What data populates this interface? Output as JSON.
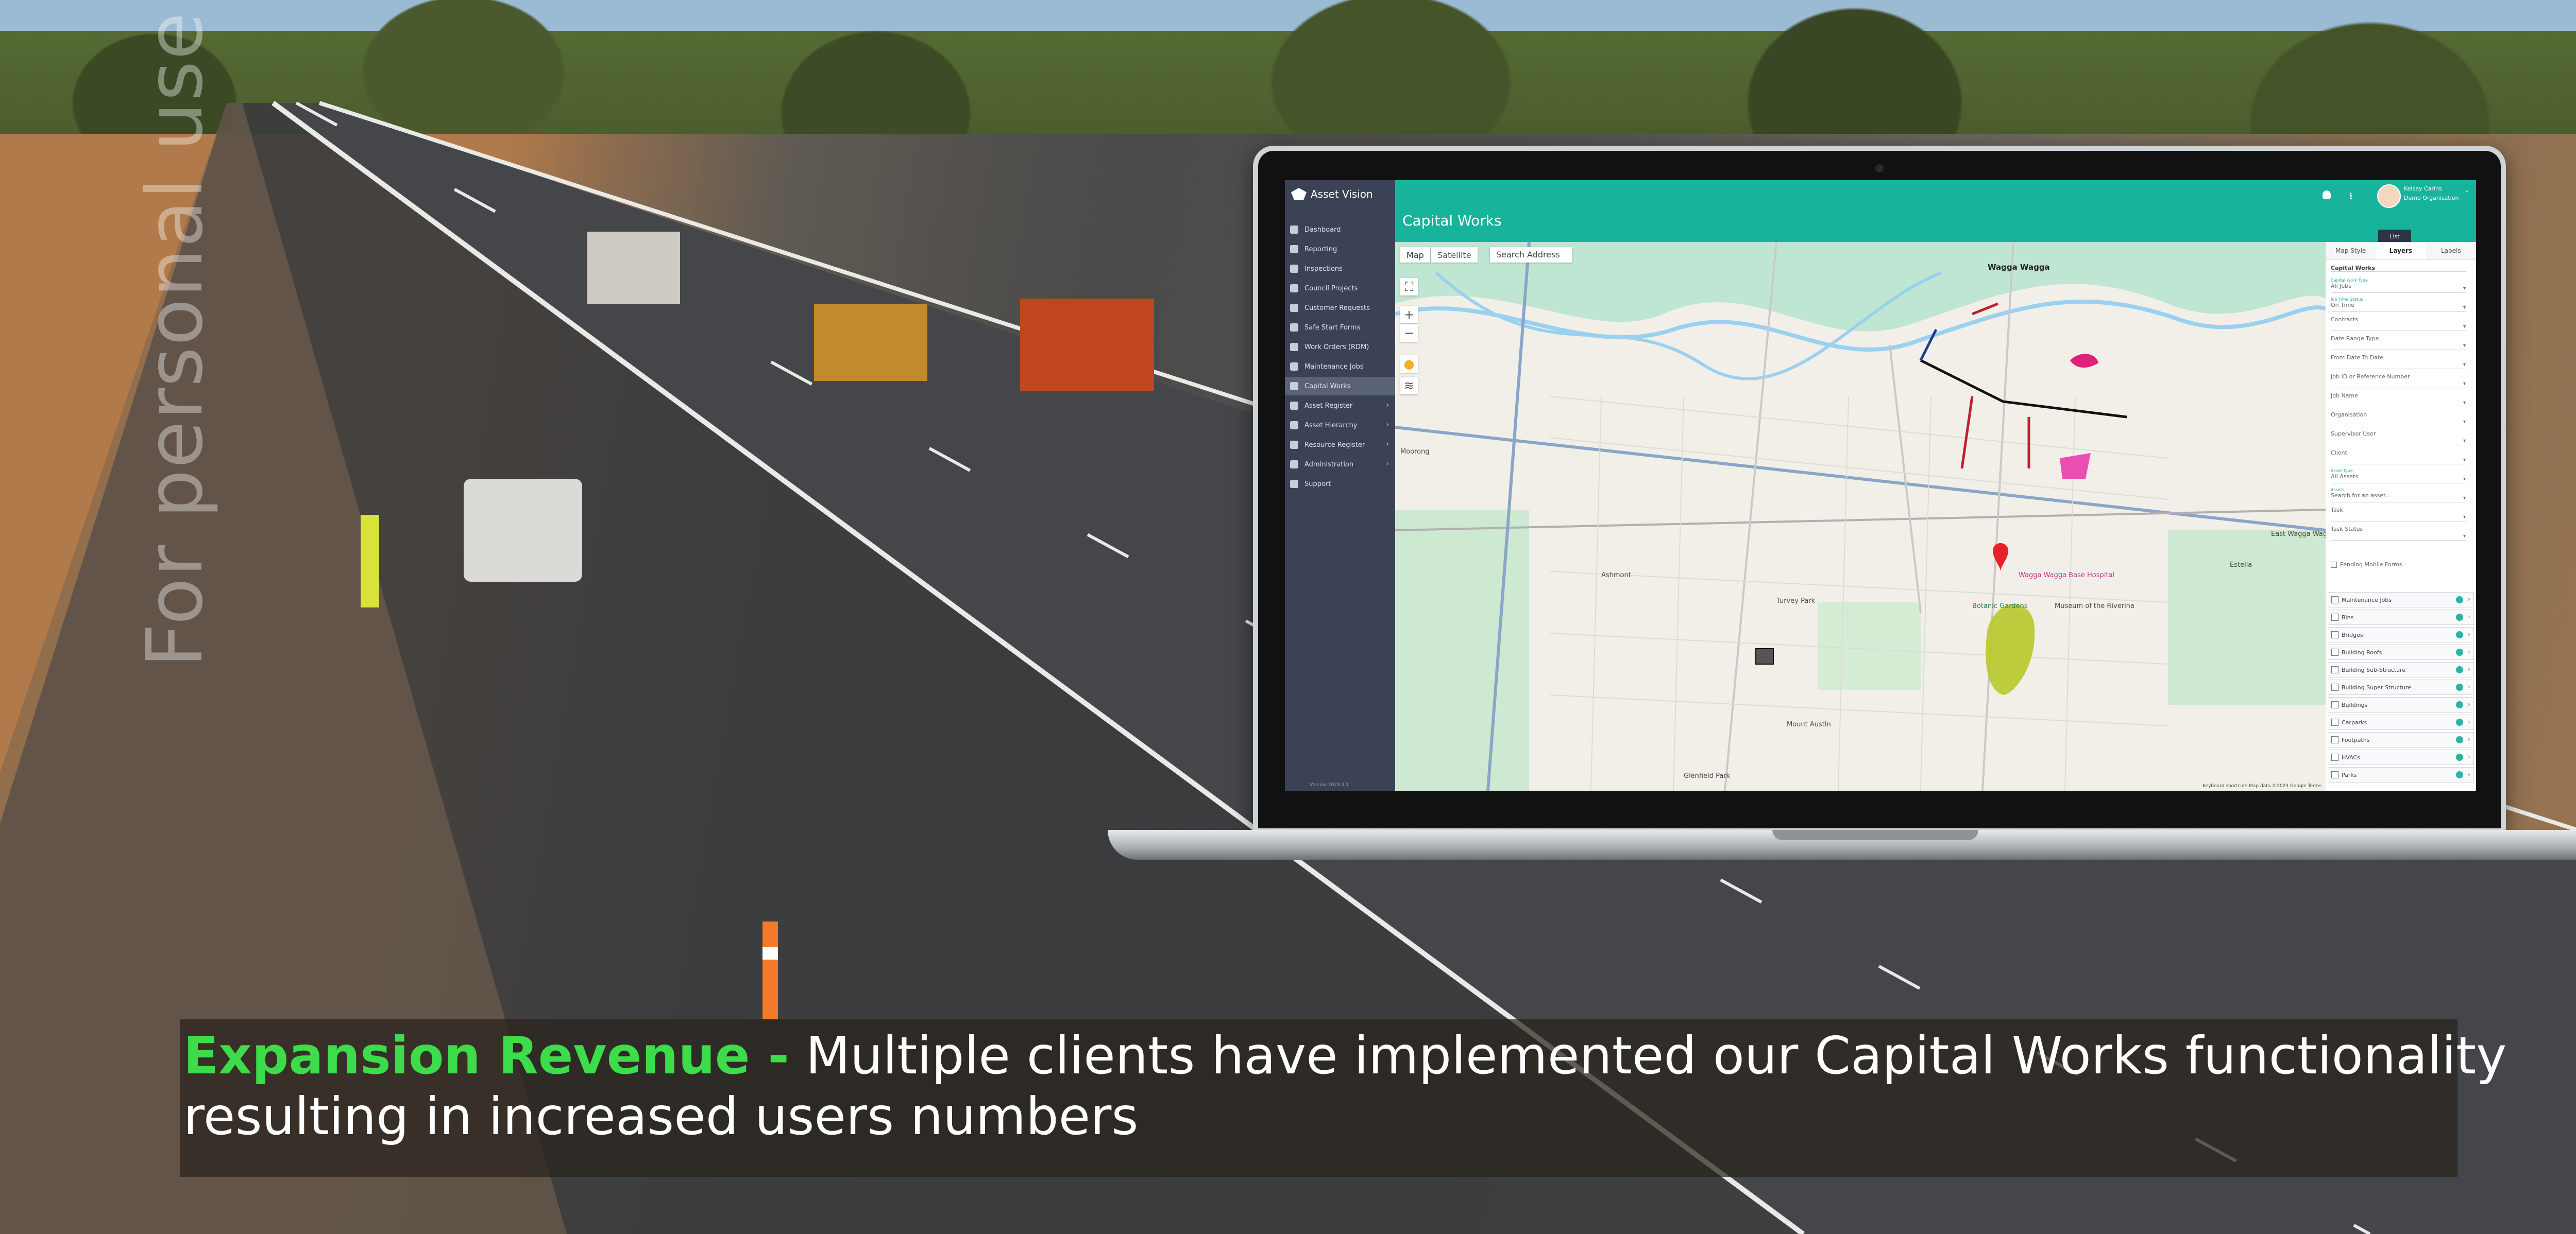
{
  "watermark": "For personal use of",
  "caption": {
    "highlight": "Expansion Revenue -",
    "line1_rest": " Multiple clients have implemented our Capital Works functionality",
    "line2": "resulting in increased users numbers",
    "highlight_color": "#3ddc4a"
  },
  "app": {
    "brand": "Asset Vision",
    "page_title": "Capital Works",
    "accent_color": "#17b39a",
    "sidebar_color": "#3b4256",
    "version": "Version 2023.3.1",
    "nav": [
      {
        "label": "Dashboard",
        "icon": "dashboard-icon",
        "chevron": false,
        "active": false
      },
      {
        "label": "Reporting",
        "icon": "reporting-icon",
        "chevron": false,
        "active": false
      },
      {
        "label": "Inspections",
        "icon": "inspections-icon",
        "chevron": false,
        "active": false
      },
      {
        "label": "Council Projects",
        "icon": "projects-icon",
        "chevron": false,
        "active": false
      },
      {
        "label": "Customer Requests",
        "icon": "requests-icon",
        "chevron": false,
        "active": false
      },
      {
        "label": "Safe Start Forms",
        "icon": "forms-icon",
        "chevron": false,
        "active": false
      },
      {
        "label": "Work Orders (RDM)",
        "icon": "work-orders-icon",
        "chevron": false,
        "active": false
      },
      {
        "label": "Maintenance Jobs",
        "icon": "maintenance-icon",
        "chevron": false,
        "active": false
      },
      {
        "label": "Capital Works",
        "icon": "capital-works-icon",
        "chevron": false,
        "active": true
      },
      {
        "label": "Asset Register",
        "icon": "asset-register-icon",
        "chevron": true,
        "active": false
      },
      {
        "label": "Asset Hierarchy",
        "icon": "hierarchy-icon",
        "chevron": true,
        "active": false
      },
      {
        "label": "Resource Register",
        "icon": "resource-icon",
        "chevron": true,
        "active": false
      },
      {
        "label": "Administration",
        "icon": "admin-icon",
        "chevron": true,
        "active": false
      },
      {
        "label": "Support",
        "icon": "support-icon",
        "chevron": false,
        "active": false
      }
    ],
    "user": {
      "name": "Kelsey Carins",
      "org": "Demo Organisation"
    },
    "list_button": "List",
    "map": {
      "map_label": "Map",
      "satellite_label": "Satellite",
      "search_placeholder": "Search Address",
      "zoom_in": "+",
      "zoom_out": "−",
      "places": [
        "Wagga Wagga",
        "Moorong",
        "Ashmont",
        "Turvey Park",
        "Mount Austin",
        "Glenfield Park",
        "Estella",
        "East Wagga Wagga",
        "Wagga Wagga Base Hospital",
        "Museum of the Riverina",
        "Botanic Gardens"
      ],
      "footer": "Keyboard shortcuts   Map data ©2023 Google   Terms"
    },
    "panel": {
      "tabs": [
        "Map Style",
        "Layers",
        "Labels"
      ],
      "active_tab": "Layers",
      "filter_title": "Capital Works",
      "fields": [
        {
          "label": "Capital Work Type",
          "value": "All Jobs"
        },
        {
          "label": "Job Time Status",
          "value": "On Time"
        },
        {
          "label": "",
          "value": "Contracts"
        },
        {
          "label": "",
          "value": "Date Range Type"
        },
        {
          "label": "",
          "value": "From Date        To Date"
        },
        {
          "label": "",
          "value": "Job ID or Reference Number"
        },
        {
          "label": "",
          "value": "Job Name"
        },
        {
          "label": "",
          "value": "Organisation"
        },
        {
          "label": "",
          "value": "Supervisor User"
        },
        {
          "label": "",
          "value": "Client"
        },
        {
          "label": "Asset Type",
          "value": "All Assets"
        },
        {
          "label": "Assets",
          "value": "Search for an asset..."
        },
        {
          "label": "",
          "value": "Task"
        },
        {
          "label": "",
          "value": "Task Status"
        }
      ],
      "pending_label": "Pending Mobile Forms",
      "layers": [
        "Maintenance Jobs",
        "Bins",
        "Bridges",
        "Building Roofs",
        "Building Sub-Structure",
        "Building Super Structure",
        "Buildings",
        "Carparks",
        "Footpaths",
        "HVACs",
        "Parks"
      ]
    }
  }
}
